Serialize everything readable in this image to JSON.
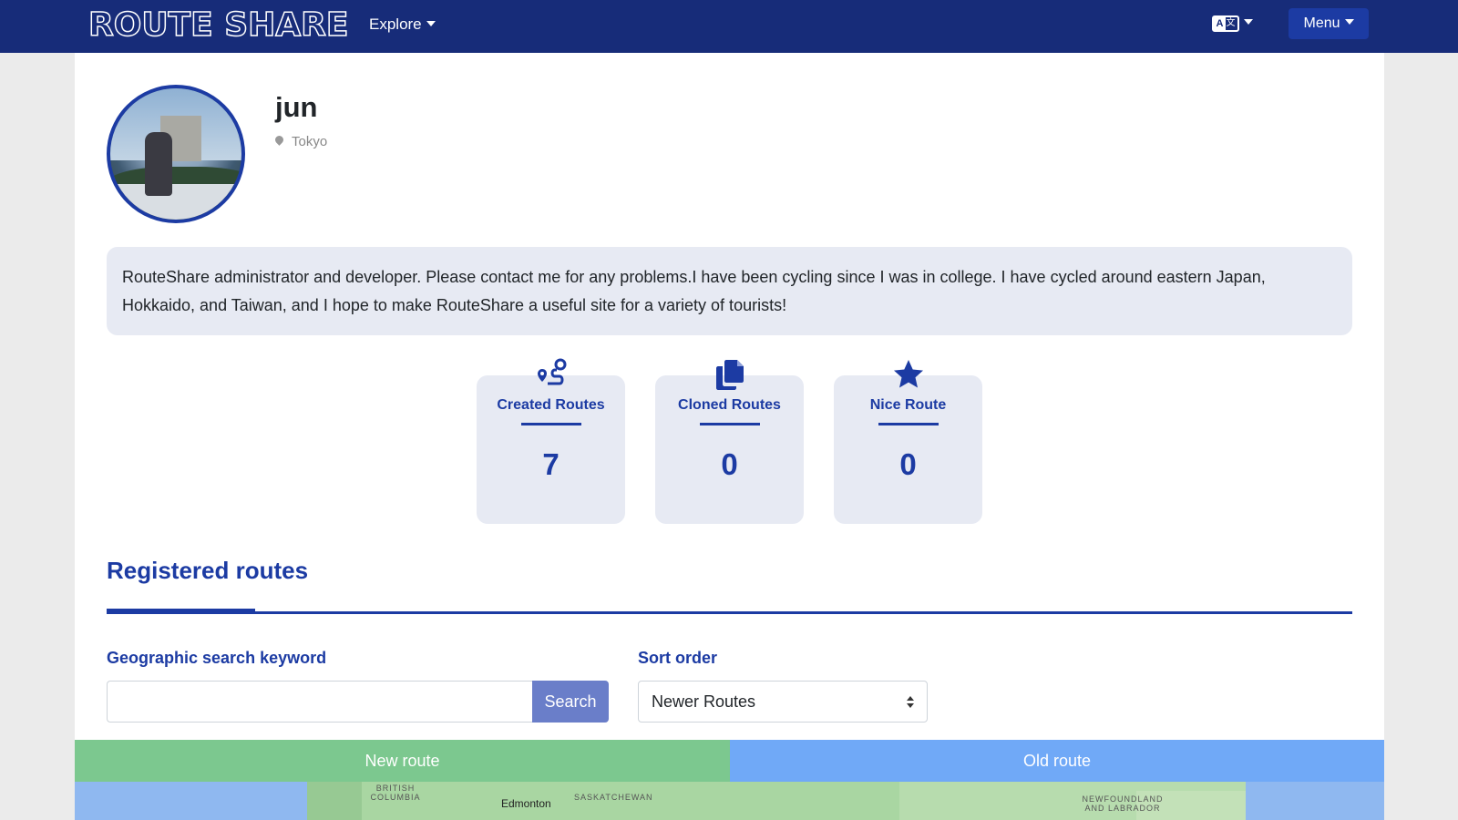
{
  "nav": {
    "brand": "ROUTE SHARE",
    "explore_label": "Explore",
    "language_icon": "translate-icon",
    "menu_label": "Menu"
  },
  "profile": {
    "name": "jun",
    "location": "Tokyo",
    "bio": "RouteShare administrator and developer. Please contact me for any problems.I have been cycling since I was in college. I have cycled around eastern Japan, Hokkaido, and Taiwan, and I hope to make RouteShare a useful site for a variety of tourists!"
  },
  "stats": [
    {
      "label": "Created Routes",
      "value": "7",
      "icon": "route-icon"
    },
    {
      "label": "Cloned Routes",
      "value": "0",
      "icon": "copy-icon"
    },
    {
      "label": "Nice Route",
      "value": "0",
      "icon": "star-icon"
    }
  ],
  "section": {
    "title": "Registered routes"
  },
  "search": {
    "label": "Geographic search keyword",
    "value": "",
    "button_label": "Search"
  },
  "sort": {
    "label": "Sort order",
    "selected": "Newer Routes"
  },
  "tabs": {
    "new_label": "New route",
    "old_label": "Old route"
  },
  "map": {
    "labels": [
      "BRITISH COLUMBIA",
      "Edmonton",
      "SASKATCHEWAN",
      "NEWFOUNDLAND AND LABRADOR"
    ]
  },
  "colors": {
    "navbar": "#172c79",
    "accent": "#1c3ba3",
    "card_bg": "#e7eaf3",
    "new_route": "#7cc88f",
    "old_route": "#70a9f7"
  }
}
